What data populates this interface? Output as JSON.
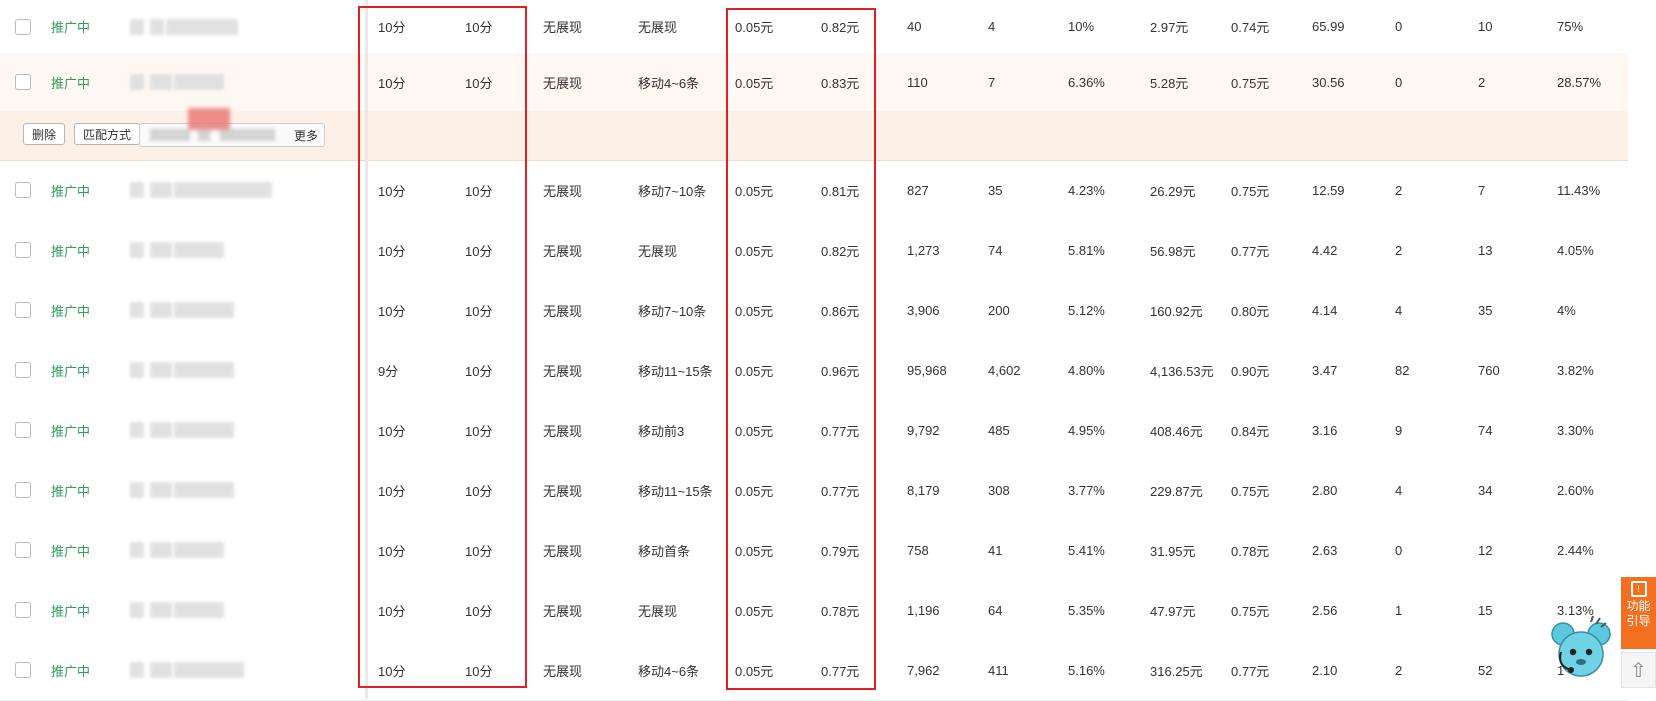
{
  "status_label": "推广中",
  "actions": {
    "delete_label": "删除",
    "match_label": "匹配方式",
    "more_label": "更多"
  },
  "sidebar": {
    "guide_label": "功能\n引导"
  },
  "rows": [
    {
      "status": "推广中",
      "score1": "10分",
      "score2": "10分",
      "pc_rank": "无展现",
      "mobile_rank": "无展现",
      "price1": "0.05元",
      "price2": "0.82元",
      "impressions": "40",
      "clicks": "4",
      "ctr": "10%",
      "cost": "2.97元",
      "cpc": "0.74元",
      "m1": "65.99",
      "m2": "0",
      "m3": "10",
      "m4": "75%"
    },
    {
      "status": "推广中",
      "score1": "10分",
      "score2": "10分",
      "pc_rank": "无展现",
      "mobile_rank": "移动4~6条",
      "price1": "0.05元",
      "price2": "0.83元",
      "impressions": "110",
      "clicks": "7",
      "ctr": "6.36%",
      "cost": "5.28元",
      "cpc": "0.75元",
      "m1": "30.56",
      "m2": "0",
      "m3": "2",
      "m4": "28.57%"
    },
    {
      "status": "推广中",
      "score1": "10分",
      "score2": "10分",
      "pc_rank": "无展现",
      "mobile_rank": "移动7~10条",
      "price1": "0.05元",
      "price2": "0.81元",
      "impressions": "827",
      "clicks": "35",
      "ctr": "4.23%",
      "cost": "26.29元",
      "cpc": "0.75元",
      "m1": "12.59",
      "m2": "2",
      "m3": "7",
      "m4": "11.43%"
    },
    {
      "status": "推广中",
      "score1": "10分",
      "score2": "10分",
      "pc_rank": "无展现",
      "mobile_rank": "无展现",
      "price1": "0.05元",
      "price2": "0.82元",
      "impressions": "1,273",
      "clicks": "74",
      "ctr": "5.81%",
      "cost": "56.98元",
      "cpc": "0.77元",
      "m1": "4.42",
      "m2": "2",
      "m3": "13",
      "m4": "4.05%"
    },
    {
      "status": "推广中",
      "score1": "10分",
      "score2": "10分",
      "pc_rank": "无展现",
      "mobile_rank": "移动7~10条",
      "price1": "0.05元",
      "price2": "0.86元",
      "impressions": "3,906",
      "clicks": "200",
      "ctr": "5.12%",
      "cost": "160.92元",
      "cpc": "0.80元",
      "m1": "4.14",
      "m2": "4",
      "m3": "35",
      "m4": "4%"
    },
    {
      "status": "推广中",
      "score1": "9分",
      "score2": "10分",
      "pc_rank": "无展现",
      "mobile_rank": "移动11~15条",
      "price1": "0.05元",
      "price2": "0.96元",
      "impressions": "95,968",
      "clicks": "4,602",
      "ctr": "4.80%",
      "cost": "4,136.53元",
      "cpc": "0.90元",
      "m1": "3.47",
      "m2": "82",
      "m3": "760",
      "m4": "3.82%"
    },
    {
      "status": "推广中",
      "score1": "10分",
      "score2": "10分",
      "pc_rank": "无展现",
      "mobile_rank": "移动前3",
      "price1": "0.05元",
      "price2": "0.77元",
      "impressions": "9,792",
      "clicks": "485",
      "ctr": "4.95%",
      "cost": "408.46元",
      "cpc": "0.84元",
      "m1": "3.16",
      "m2": "9",
      "m3": "74",
      "m4": "3.30%"
    },
    {
      "status": "推广中",
      "score1": "10分",
      "score2": "10分",
      "pc_rank": "无展现",
      "mobile_rank": "移动11~15条",
      "price1": "0.05元",
      "price2": "0.77元",
      "impressions": "8,179",
      "clicks": "308",
      "ctr": "3.77%",
      "cost": "229.87元",
      "cpc": "0.75元",
      "m1": "2.80",
      "m2": "4",
      "m3": "34",
      "m4": "2.60%"
    },
    {
      "status": "推广中",
      "score1": "10分",
      "score2": "10分",
      "pc_rank": "无展现",
      "mobile_rank": "移动首条",
      "price1": "0.05元",
      "price2": "0.79元",
      "impressions": "758",
      "clicks": "41",
      "ctr": "5.41%",
      "cost": "31.95元",
      "cpc": "0.78元",
      "m1": "2.63",
      "m2": "0",
      "m3": "12",
      "m4": "2.44%"
    },
    {
      "status": "推广中",
      "score1": "10分",
      "score2": "10分",
      "pc_rank": "无展现",
      "mobile_rank": "无展现",
      "price1": "0.05元",
      "price2": "0.78元",
      "impressions": "1,196",
      "clicks": "64",
      "ctr": "5.35%",
      "cost": "47.97元",
      "cpc": "0.75元",
      "m1": "2.56",
      "m2": "1",
      "m3": "15",
      "m4": "3.13%"
    },
    {
      "status": "推广中",
      "score1": "10分",
      "score2": "10分",
      "pc_rank": "无展现",
      "mobile_rank": "移动4~6条",
      "price1": "0.05元",
      "price2": "0.77元",
      "impressions": "7,962",
      "clicks": "411",
      "ctr": "5.16%",
      "cost": "316.25元",
      "cpc": "0.77元",
      "m1": "2.10",
      "m2": "2",
      "m3": "52",
      "m4": "1"
    }
  ]
}
